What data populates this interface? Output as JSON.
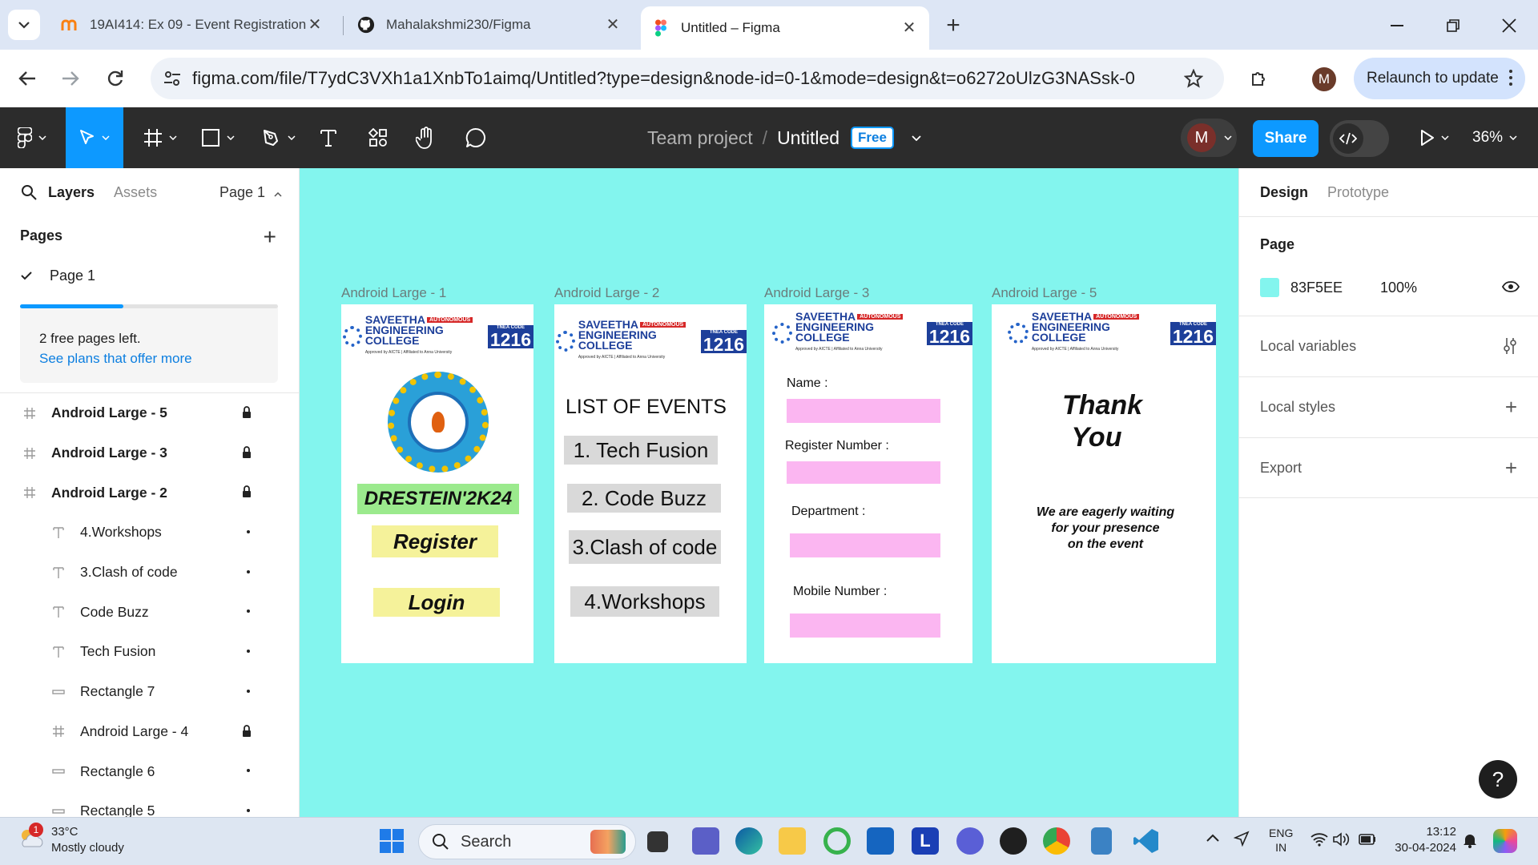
{
  "browser": {
    "tabs": [
      {
        "title": "19AI414: Ex 09 - Event Registration",
        "icon": "moodle-icon"
      },
      {
        "title": "Mahalakshmi230/Figma",
        "icon": "github-icon"
      },
      {
        "title": "Untitled – Figma",
        "icon": "figma-icon",
        "active": true
      }
    ],
    "url": "figma.com/file/T7ydC3VXh1a1XnbTo1aimq/Untitled?type=design&node-id=0-1&mode=design&t=o6272oUlzG3NASsk-0",
    "profile_initial": "M",
    "relaunch_label": "Relaunch to update"
  },
  "figma": {
    "project": "Team project",
    "file_name": "Untitled",
    "plan_badge": "Free",
    "user_initial": "M",
    "share_label": "Share",
    "zoom": "36%",
    "left_panel": {
      "tab_layers": "Layers",
      "tab_assets": "Assets",
      "page_selector": "Page 1",
      "pages_header": "Pages",
      "pages": [
        "Page 1"
      ],
      "upsell_text": "2 free pages left.",
      "upsell_link": "See plans that offer more",
      "layers": [
        {
          "name": "Android Large - 5",
          "type": "frame",
          "level": 0
        },
        {
          "name": "Android Large - 3",
          "type": "frame",
          "level": 0
        },
        {
          "name": "Android Large - 2",
          "type": "frame",
          "level": 0
        },
        {
          "name": "4.Workshops",
          "type": "text",
          "level": 1
        },
        {
          "name": "3.Clash of code",
          "type": "text",
          "level": 1
        },
        {
          "name": "Code Buzz",
          "type": "text",
          "level": 1
        },
        {
          "name": "Tech Fusion",
          "type": "text",
          "level": 1
        },
        {
          "name": "Rectangle 7",
          "type": "rect",
          "level": 1
        },
        {
          "name": "Android Large - 4",
          "type": "frame",
          "level": 1
        },
        {
          "name": "Rectangle 6",
          "type": "rect",
          "level": 1
        },
        {
          "name": "Rectangle 5",
          "type": "rect",
          "level": 1
        }
      ]
    },
    "canvas": {
      "background": "#83F5EE",
      "college_name_line1": "SAVEETHA",
      "college_name_line2": "ENGINEERING COLLEGE",
      "autonomous": "AUTONOMOUS",
      "approval": "Approved by AICTE | Affiliated to Anna University",
      "tnea": "TNEA CODE",
      "tnea_code": "1216",
      "frames": {
        "f1": {
          "label": "Android Large - 1",
          "event_title": "DRESTEIN'2K24",
          "register": "Register",
          "login": "Login"
        },
        "f2": {
          "label": "Android Large - 2",
          "heading": "LIST OF EVENTS",
          "events": [
            "1. Tech Fusion",
            "2. Code Buzz",
            "3.Clash of code",
            "4.Workshops"
          ]
        },
        "f3": {
          "label": "Android Large - 3",
          "fields": [
            "Name :",
            "Register Number :",
            "Department :",
            "Mobile Number :"
          ]
        },
        "f5": {
          "label": "Android Large - 5",
          "thank_line1": "Thank",
          "thank_line2": "You",
          "message_line1": "We are eagerly waiting",
          "message_line2": "for your presence",
          "message_line3": "on the event"
        }
      }
    },
    "right_panel": {
      "tab_design": "Design",
      "tab_prototype": "Prototype",
      "page_label": "Page",
      "page_color_hex": "83F5EE",
      "page_opacity": "100%",
      "local_variables": "Local variables",
      "local_styles": "Local styles",
      "export": "Export"
    },
    "help": "?"
  },
  "taskbar": {
    "weather_temp": "33°C",
    "weather_desc": "Mostly cloudy",
    "weather_badge": "1",
    "search_label": "Search",
    "lang_line1": "ENG",
    "lang_line2": "IN",
    "time": "13:12",
    "date": "30-04-2024"
  }
}
